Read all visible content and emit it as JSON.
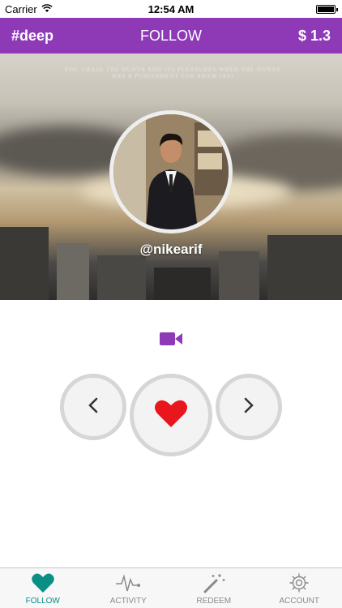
{
  "status_bar": {
    "carrier": "Carrier",
    "time": "12:54 AM"
  },
  "nav": {
    "tag": "#deep",
    "title": "FOLLOW",
    "balance": "$ 1.3"
  },
  "hero": {
    "quote": "YOU CHASE THE DUNYA AND ITS PLEASURES WHEN THE DUNYA WAS A PUNISHMENT FOR ADAM (AS)",
    "username": "@nikearif"
  },
  "colors": {
    "brand": "#8e3ab6",
    "heart": "#e8171d",
    "tab_active": "#0a8f86",
    "tab_inactive": "#8a8a8a"
  },
  "actions": {
    "prev_icon": "chevron-left-icon",
    "like_icon": "heart-icon",
    "next_icon": "chevron-right-icon",
    "media_icon": "video-camera-icon"
  },
  "tabbar": {
    "items": [
      {
        "label": "FOLLOW",
        "icon": "heart-icon",
        "active": true
      },
      {
        "label": "ACTIVITY",
        "icon": "pulse-icon",
        "active": false
      },
      {
        "label": "REDEEM",
        "icon": "magic-wand-icon",
        "active": false
      },
      {
        "label": "ACCOUNT",
        "icon": "gear-icon",
        "active": false
      }
    ]
  }
}
